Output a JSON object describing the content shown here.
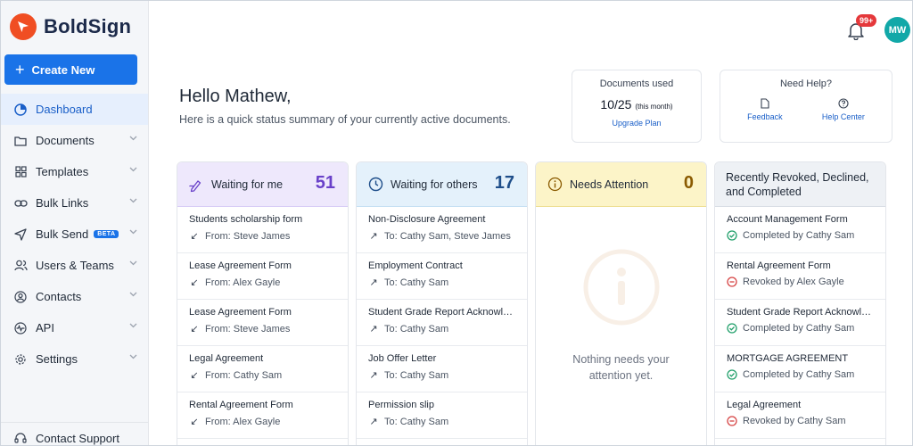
{
  "app": {
    "name": "BoldSign"
  },
  "sidebar": {
    "create_label": "Create New",
    "items": [
      {
        "label": "Dashboard",
        "icon": "dashboard-icon"
      },
      {
        "label": "Documents",
        "icon": "folder-icon"
      },
      {
        "label": "Templates",
        "icon": "templates-icon"
      },
      {
        "label": "Bulk Links",
        "icon": "link-icon"
      },
      {
        "label": "Bulk Send",
        "icon": "send-icon",
        "badge": "BETA"
      },
      {
        "label": "Users & Teams",
        "icon": "users-icon"
      },
      {
        "label": "Contacts",
        "icon": "contacts-icon"
      },
      {
        "label": "API",
        "icon": "api-icon"
      },
      {
        "label": "Settings",
        "icon": "gear-icon"
      }
    ],
    "support_label": "Contact Support"
  },
  "header": {
    "notification_count": "99+",
    "avatar_initials": "MW"
  },
  "greeting": {
    "title": "Hello Mathew,",
    "subtitle": "Here is a quick status summary of your currently active documents."
  },
  "usage": {
    "title": "Documents used",
    "count": "10/25",
    "period": "(this month)",
    "link": "Upgrade Plan"
  },
  "help": {
    "title": "Need Help?",
    "feedback": "Feedback",
    "help_center": "Help Center"
  },
  "columns": {
    "waiting_me": {
      "title": "Waiting for me",
      "count": "51",
      "items": [
        {
          "doc": "Students scholarship form",
          "meta": "From: Steve James"
        },
        {
          "doc": "Lease Agreement Form",
          "meta": "From: Alex Gayle"
        },
        {
          "doc": "Lease Agreement Form",
          "meta": "From: Steve James"
        },
        {
          "doc": "Legal Agreement",
          "meta": "From: Cathy Sam"
        },
        {
          "doc": "Rental Agreement Form",
          "meta": "From: Alex Gayle"
        }
      ]
    },
    "waiting_others": {
      "title": "Waiting for others",
      "count": "17",
      "items": [
        {
          "doc": "Non-Disclosure Agreement",
          "meta": "To: Cathy Sam, Steve James"
        },
        {
          "doc": "Employment Contract",
          "meta": "To: Cathy Sam"
        },
        {
          "doc": "Student Grade Report Acknowle...",
          "meta": "To: Cathy Sam"
        },
        {
          "doc": "Job Offer Letter",
          "meta": "To: Cathy Sam"
        },
        {
          "doc": "Permission slip",
          "meta": "To: Cathy Sam"
        }
      ]
    },
    "attention": {
      "title": "Needs Attention",
      "count": "0",
      "empty": "Nothing needs your attention yet."
    },
    "recent": {
      "title": "Recently Revoked, Declined, and Completed",
      "items": [
        {
          "doc": "Account Management Form",
          "meta": "Completed by Cathy Sam",
          "status": "completed"
        },
        {
          "doc": "Rental Agreement Form",
          "meta": "Revoked by Alex Gayle",
          "status": "revoked"
        },
        {
          "doc": "Student Grade Report Acknowle...",
          "meta": "Completed by Cathy Sam",
          "status": "completed"
        },
        {
          "doc": "MORTGAGE AGREEMENT",
          "meta": "Completed by Cathy Sam",
          "status": "completed"
        },
        {
          "doc": "Legal Agreement",
          "meta": "Revoked by Cathy Sam",
          "status": "revoked"
        }
      ]
    }
  },
  "colors": {
    "accent": "#1a73e8",
    "brand": "#f04e23",
    "completed": "#22a06b",
    "revoked": "#d64545"
  }
}
